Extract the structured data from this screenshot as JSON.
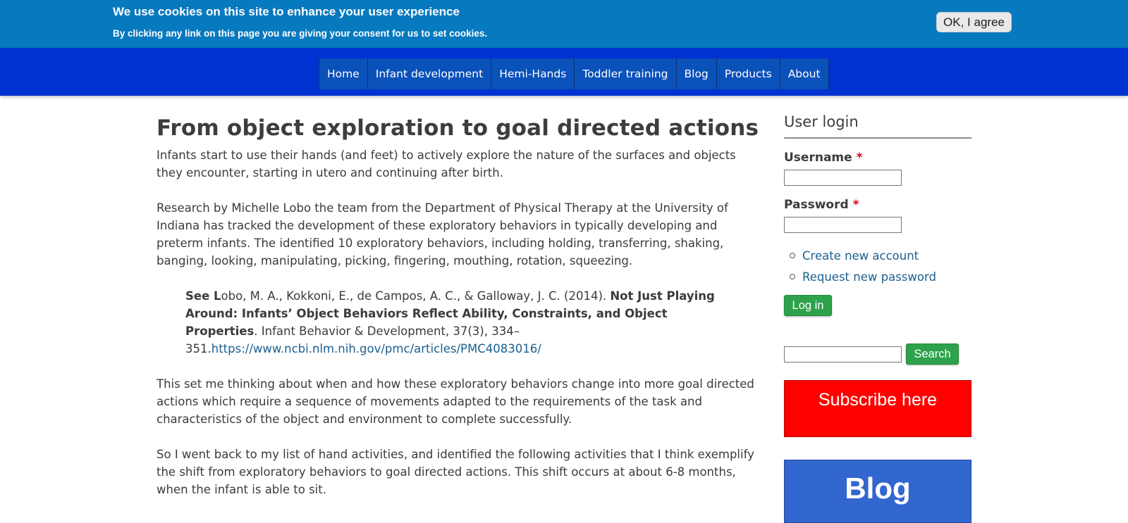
{
  "cookie_banner": {
    "title": "We use cookies on this site to enhance your user experience",
    "subtitle": "By clicking any link on this page you are giving your consent for us to set cookies.",
    "agree_label": "OK, I agree"
  },
  "nav": {
    "items": [
      "Home",
      "Infant development",
      "Hemi-Hands",
      "Toddler training",
      "Blog",
      "Products",
      "About"
    ]
  },
  "article": {
    "title": "From object exploration to goal directed actions",
    "p1": "Infants start to use their hands (and feet) to actively explore the nature of the surfaces and objects they encounter, starting in utero and continuing after birth.",
    "p2": "Research by Michelle Lobo the team from the Department of Physical Therapy at the University of Indiana has tracked the development of these exploratory behaviors in typically developing and preterm infants.  The identified 10 exploratory behaviors, including holding, transferring, shaking, banging, looking, manipulating, picking, fingering, mouthing, rotation, squeezing.",
    "citation": {
      "see": "See L",
      "authors": "obo, M. A., Kokkoni, E., de Campos, A. C., & Galloway, J. C. (2014). ",
      "title": "Not Just Playing Around: Infants’ Object Behaviors Reflect Ability, Constraints, and Object Properties",
      "journal": ". Infant Behavior & Development, 37(3), 334–351.",
      "url": "https://www.ncbi.nlm.nih.gov/pmc/articles/PMC4083016/"
    },
    "p3": "This set me thinking about when and how these exploratory behaviors change into more goal directed actions which require a sequence of movements adapted to the requirements of the task and characteristics of the object and environment to complete successfully.",
    "p4": "So I went back to my list of hand activities, and identified the following activities that I think exemplify the shift from exploratory behaviors to goal directed actions. This shift occurs at about 6-8 months, when the infant is able to sit."
  },
  "sidebar": {
    "login_title": "User login",
    "username_label": "Username",
    "password_label": "Password",
    "required_mark": "*",
    "links": [
      "Create new account",
      "Request new password"
    ],
    "login_button": "Log in",
    "search_button": "Search",
    "subscribe_label": "Subscribe here",
    "blog_label": "Blog"
  },
  "colors": {
    "cookie_bg": "#0779bf",
    "nav_bg": "#0032d2",
    "nav_item_bg": "#0b51ba",
    "button_green": "#2da24b",
    "subscribe_red": "#ff0000",
    "blog_blue": "#3267d0",
    "link": "#1c5f8f"
  }
}
